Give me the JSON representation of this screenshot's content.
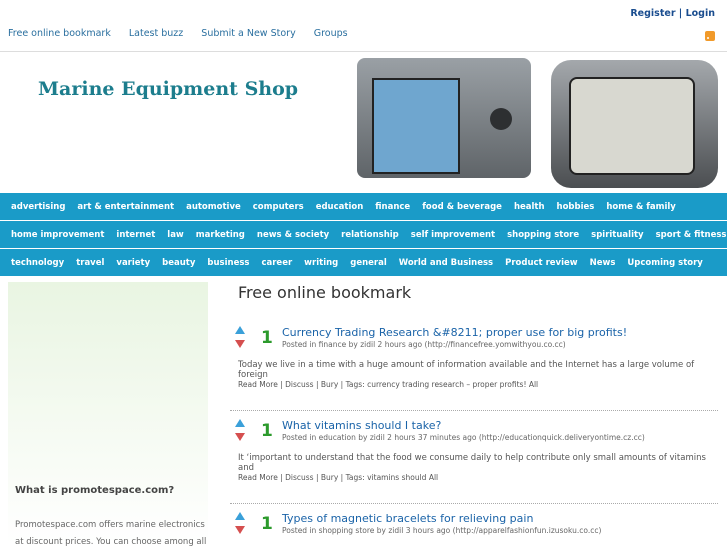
{
  "top": {
    "links": [
      "Free online bookmark",
      "Latest buzz",
      "Submit a New Story",
      "Groups"
    ],
    "auth": [
      "Register",
      "Login"
    ]
  },
  "header": {
    "title": "Marine Equipment Shop"
  },
  "nav": [
    [
      "advertising",
      "art & entertainment",
      "automotive",
      "computers",
      "education",
      "finance",
      "food & beverage",
      "health",
      "hobbies",
      "home & family"
    ],
    [
      "home improvement",
      "internet",
      "law",
      "marketing",
      "news & society",
      "relationship",
      "self improvement",
      "shopping store",
      "spirituality",
      "sport & fitness"
    ],
    [
      "technology",
      "travel",
      "variety",
      "beauty",
      "business",
      "career",
      "writing",
      "general",
      "World and Business",
      "Product review",
      "News",
      "Upcoming story"
    ]
  ],
  "sidebar": {
    "heading": "What is promotespace.com?",
    "text": "Promotespace.com offers marine electronics at discount prices. You can choose among all"
  },
  "main": {
    "heading": "Free online bookmark",
    "stories": [
      {
        "votes": "1",
        "title": "Currency Trading Research &#8211; proper use for big profits!",
        "meta": "Posted in finance by zidil 2 hours ago (http://financefree.yomwithyou.co.cc)",
        "desc": "Today we live in a time with a huge amount of information available and the Internet has a large volume of foreign",
        "actions": "Read More | Discuss  |  Bury | Tags: currency trading research – proper profits! All"
      },
      {
        "votes": "1",
        "title": "What vitamins should I take?",
        "meta": "Posted in education by zidil 2 hours 37 minutes ago (http://educationquick.deliveryontime.cz.cc)",
        "desc": "It ‘important to understand that the food we consume daily to help contribute only small amounts of vitamins and",
        "actions": "Read More | Discuss  |  Bury | Tags: vitamins should All"
      },
      {
        "votes": "1",
        "title": "Types of magnetic bracelets for relieving pain",
        "meta": "Posted in shopping store by zidil 3 hours ago (http://apparelfashionfun.izusoku.co.cc)",
        "desc": "",
        "actions": ""
      }
    ]
  },
  "colors": {
    "nav": "#1a9bc8",
    "title": "#1c7d8d",
    "link": "#1a63a8",
    "vote": "#2c9a2c"
  }
}
